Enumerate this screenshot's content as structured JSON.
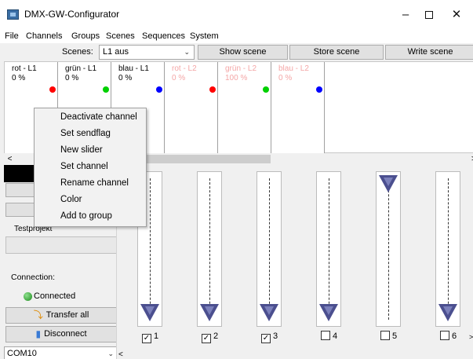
{
  "window": {
    "title": "DMX-GW-Configurator",
    "controls": {
      "minimize": "–",
      "maximize": "",
      "close": "✕"
    }
  },
  "menu": [
    "File",
    "Channels",
    "Groups",
    "Scenes",
    "Sequences",
    "System"
  ],
  "toolbar": {
    "scenes_label": "Scenes:",
    "scene_selected": "L1 aus",
    "show_scene": "Show scene",
    "store_scene": "Store scene",
    "write_scene": "Write scene"
  },
  "channels": [
    {
      "name": "rot - L1",
      "value": "0 %",
      "color": "#ff0000",
      "active": true
    },
    {
      "name": "grün - L1",
      "value": "0 %",
      "color": "#00d000",
      "active": true
    },
    {
      "name": "blau - L1",
      "value": "0 %",
      "color": "#0000ff",
      "active": true
    },
    {
      "name": "rot - L2",
      "value": "0 %",
      "color": "#ff0000",
      "active": false
    },
    {
      "name": "grün - L2",
      "value": "100 %",
      "color": "#00d000",
      "active": false
    },
    {
      "name": "blau - L2",
      "value": "0 %",
      "color": "#0000ff",
      "active": false
    }
  ],
  "context_menu": [
    "Deactivate channel",
    "Set sendflag",
    "New slider",
    "Set channel",
    "Rename channel",
    "Color",
    "Add to group"
  ],
  "left_panel": {
    "project_label": "Testprojekt",
    "connection_label": "Connection:",
    "status": "Connected",
    "status_color": "#1b8a1b",
    "transfer_all": "Transfer all",
    "disconnect": "Disconnect",
    "port": "COM10"
  },
  "sliders": [
    {
      "label": "1",
      "checked": true,
      "level": 0.0
    },
    {
      "label": "2",
      "checked": true,
      "level": 0.0
    },
    {
      "label": "3",
      "checked": true,
      "level": 0.0
    },
    {
      "label": "4",
      "checked": false,
      "level": 0.0
    },
    {
      "label": "5",
      "checked": false,
      "level": 1.0
    },
    {
      "label": "6",
      "checked": false,
      "level": 0.0
    }
  ],
  "icons": {
    "scroll_left": "<",
    "scroll_right": ">",
    "dropdown": "chevron-down-icon",
    "check": "✓",
    "transfer": "transfer-icon",
    "disconnect": "disconnect-icon"
  }
}
